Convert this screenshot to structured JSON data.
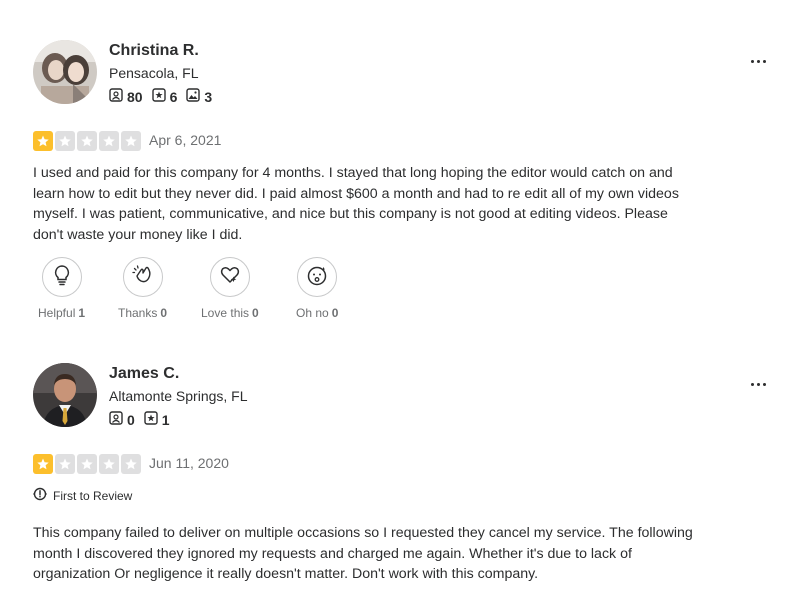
{
  "reviews": [
    {
      "user": {
        "name": "Christina R.",
        "location": "Pensacola, FL",
        "stats": {
          "friends": "80",
          "reviews": "6",
          "photos": "3"
        }
      },
      "rating": 1,
      "date": "Apr 6, 2021",
      "text": "I used and paid for this company for 4 months. I stayed that long hoping the editor would catch on and learn how to edit but they never did. I paid almost $600 a month and had to re edit all of my own videos myself. I was patient, communicative, and nice but this company is not good at editing videos. Please don't waste your money like I did.",
      "reactions": [
        {
          "label": "Helpful",
          "count": "1",
          "icon": "lightbulb-icon"
        },
        {
          "label": "Thanks",
          "count": "0",
          "icon": "clapping-hands-icon"
        },
        {
          "label": "Love this",
          "count": "0",
          "icon": "heart-sparkle-icon"
        },
        {
          "label": "Oh no",
          "count": "0",
          "icon": "surprised-face-icon"
        }
      ]
    },
    {
      "user": {
        "name": "James C.",
        "location": "Altamonte Springs, FL",
        "stats": {
          "friends": "0",
          "reviews": "1"
        }
      },
      "rating": 1,
      "date": "Jun 11, 2020",
      "badge": "First to Review",
      "text": "This company failed to deliver on multiple occasions so I requested they cancel my service. The following month I discovered they ignored my requests and charged me again. Whether it's due to lack of organization Or negligence it really doesn't matter. Don't work with this company."
    }
  ],
  "colors": {
    "star_filled": "#fcbf2c",
    "star_empty": "#dfdfe0",
    "text": "#2d2e2f",
    "muted": "#6e7072"
  }
}
